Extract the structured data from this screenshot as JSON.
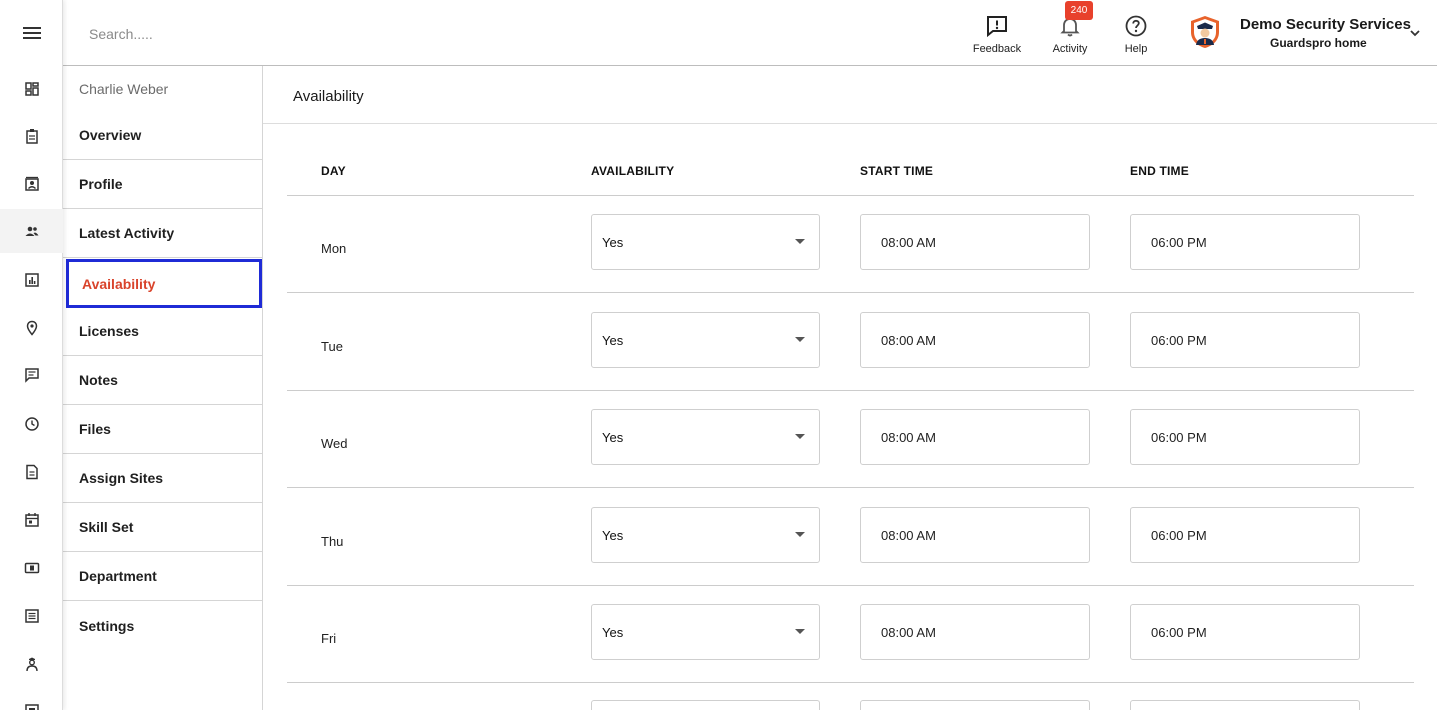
{
  "header": {
    "search_placeholder": "Search.....",
    "feedback_label": "Feedback",
    "activity_label": "Activity",
    "activity_count": "240",
    "help_label": "Help",
    "company_name": "Demo Security Services",
    "company_sub": "Guardspro home"
  },
  "rail": {
    "icons": [
      "menu-icon",
      "dashboard-icon",
      "clipboard-icon",
      "contact-card-icon",
      "people-icon",
      "report-chart-icon",
      "location-pin-icon",
      "chat-icon",
      "clock-icon",
      "document-icon",
      "calendar-icon",
      "money-icon",
      "list-icon",
      "guard-user-icon",
      "id-card-icon"
    ],
    "active": "people-icon"
  },
  "subnav": {
    "person_name": "Charlie Weber",
    "items": [
      {
        "label": "Overview"
      },
      {
        "label": "Profile"
      },
      {
        "label": "Latest Activity"
      },
      {
        "label": "Availability"
      },
      {
        "label": "Licenses"
      },
      {
        "label": "Notes"
      },
      {
        "label": "Files"
      },
      {
        "label": "Assign Sites"
      },
      {
        "label": "Skill Set"
      },
      {
        "label": "Department"
      },
      {
        "label": "Settings"
      }
    ],
    "active": "Availability"
  },
  "main": {
    "title": "Availability",
    "columns": {
      "day": "DAY",
      "availability": "AVAILABILITY",
      "start": "START TIME",
      "end": "END TIME"
    },
    "rows": [
      {
        "day": "Mon",
        "availability": "Yes",
        "start": "08:00 AM",
        "end": "06:00 PM"
      },
      {
        "day": "Tue",
        "availability": "Yes",
        "start": "08:00 AM",
        "end": "06:00 PM"
      },
      {
        "day": "Wed",
        "availability": "Yes",
        "start": "08:00 AM",
        "end": "06:00 PM"
      },
      {
        "day": "Thu",
        "availability": "Yes",
        "start": "08:00 AM",
        "end": "06:00 PM"
      },
      {
        "day": "Fri",
        "availability": "Yes",
        "start": "08:00 AM",
        "end": "06:00 PM"
      }
    ]
  },
  "colors": {
    "accent": "#d9432b",
    "focus_border": "#1f2bd6",
    "badge": "#e8412c"
  }
}
